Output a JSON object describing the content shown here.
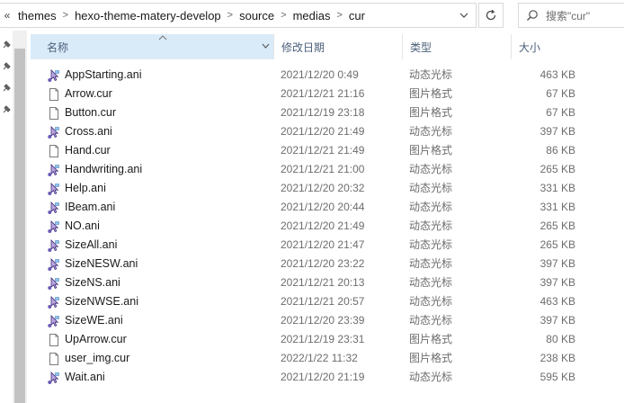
{
  "address_bar": {
    "overflow_label": "«",
    "crumbs": [
      "themes",
      "hexo-theme-matery-develop",
      "source",
      "medias",
      "cur"
    ],
    "separator": ">"
  },
  "search": {
    "placeholder": "搜索\"cur\""
  },
  "columns": {
    "name": "名称",
    "date": "修改日期",
    "type": "类型",
    "size": "大小"
  },
  "files": [
    {
      "name": "AppStarting.ani",
      "date": "2021/12/20 0:49",
      "type": "动态光标",
      "size": "463 KB",
      "icon": "animated-cursor-icon"
    },
    {
      "name": "Arrow.cur",
      "date": "2021/12/21 21:16",
      "type": "图片格式",
      "size": "67 KB",
      "icon": "document-icon"
    },
    {
      "name": "Button.cur",
      "date": "2021/12/19 23:18",
      "type": "图片格式",
      "size": "67 KB",
      "icon": "document-icon"
    },
    {
      "name": "Cross.ani",
      "date": "2021/12/20 21:49",
      "type": "动态光标",
      "size": "397 KB",
      "icon": "animated-cursor-icon"
    },
    {
      "name": "Hand.cur",
      "date": "2021/12/21 21:49",
      "type": "图片格式",
      "size": "86 KB",
      "icon": "document-icon"
    },
    {
      "name": "Handwriting.ani",
      "date": "2021/12/21 21:00",
      "type": "动态光标",
      "size": "265 KB",
      "icon": "animated-cursor-icon"
    },
    {
      "name": "Help.ani",
      "date": "2021/12/20 20:32",
      "type": "动态光标",
      "size": "331 KB",
      "icon": "animated-cursor-icon"
    },
    {
      "name": "IBeam.ani",
      "date": "2021/12/20 20:44",
      "type": "动态光标",
      "size": "331 KB",
      "icon": "animated-cursor-icon"
    },
    {
      "name": "NO.ani",
      "date": "2021/12/20 21:49",
      "type": "动态光标",
      "size": "265 KB",
      "icon": "animated-cursor-icon"
    },
    {
      "name": "SizeAll.ani",
      "date": "2021/12/20 21:47",
      "type": "动态光标",
      "size": "265 KB",
      "icon": "animated-cursor-icon"
    },
    {
      "name": "SizeNESW.ani",
      "date": "2021/12/20 23:22",
      "type": "动态光标",
      "size": "397 KB",
      "icon": "animated-cursor-icon"
    },
    {
      "name": "SizeNS.ani",
      "date": "2021/12/21 20:13",
      "type": "动态光标",
      "size": "397 KB",
      "icon": "animated-cursor-icon"
    },
    {
      "name": "SizeNWSE.ani",
      "date": "2021/12/21 20:57",
      "type": "动态光标",
      "size": "463 KB",
      "icon": "animated-cursor-icon"
    },
    {
      "name": "SizeWE.ani",
      "date": "2021/12/20 23:39",
      "type": "动态光标",
      "size": "397 KB",
      "icon": "animated-cursor-icon"
    },
    {
      "name": "UpArrow.cur",
      "date": "2021/12/19 23:31",
      "type": "图片格式",
      "size": "80 KB",
      "icon": "document-icon"
    },
    {
      "name": "user_img.cur",
      "date": "2022/1/22 11:32",
      "type": "图片格式",
      "size": "238 KB",
      "icon": "document-icon"
    },
    {
      "name": "Wait.ani",
      "date": "2021/12/20 21:19",
      "type": "动态光标",
      "size": "595 KB",
      "icon": "animated-cursor-icon"
    }
  ],
  "colors": {
    "header_text": "#4c607a",
    "sorted_column_bg": "#d9ebf9",
    "secondary_text": "#6d6d6d"
  }
}
